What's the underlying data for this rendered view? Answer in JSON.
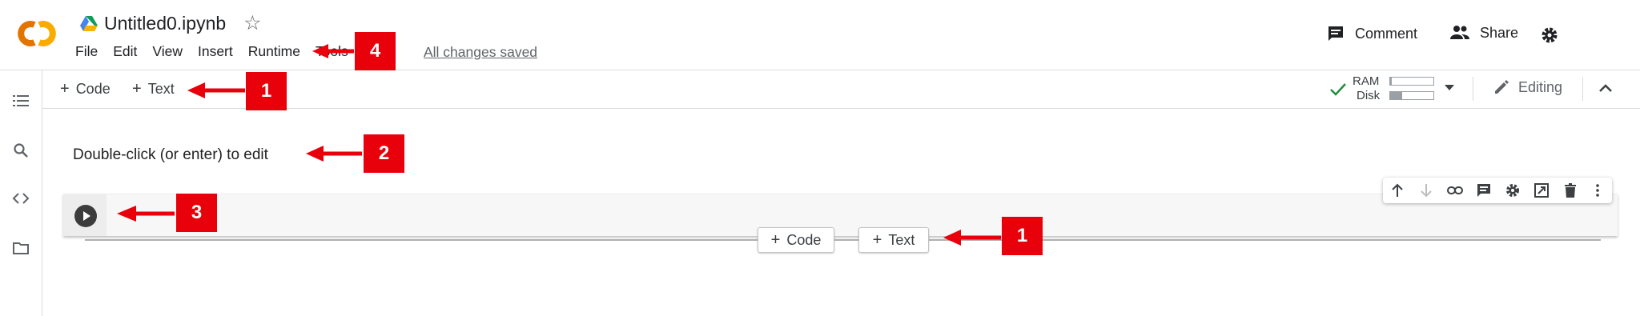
{
  "header": {
    "notebook_title": "Untitled0.ipynb",
    "menu": [
      "File",
      "Edit",
      "View",
      "Insert",
      "Runtime",
      "Tools"
    ],
    "save_status": "All changes saved",
    "comment_label": "Comment",
    "share_label": "Share"
  },
  "toolbar": {
    "add_code_label": "Code",
    "add_text_label": "Text",
    "ram_label": "RAM",
    "disk_label": "Disk",
    "ram_usage": 0.03,
    "disk_usage": 0.28,
    "mode_label": "Editing"
  },
  "notebook": {
    "text_cell": "Double-click (or enter) to edit",
    "add_code_label": "Code",
    "add_text_label": "Text"
  },
  "annotations": [
    "1",
    "2",
    "3",
    "1",
    "4"
  ],
  "colors": {
    "annotation": "#e8000b",
    "connected_check": "#1e8e3e",
    "logo_orange": "#f9ab00",
    "logo_dark_orange": "#e37400"
  }
}
